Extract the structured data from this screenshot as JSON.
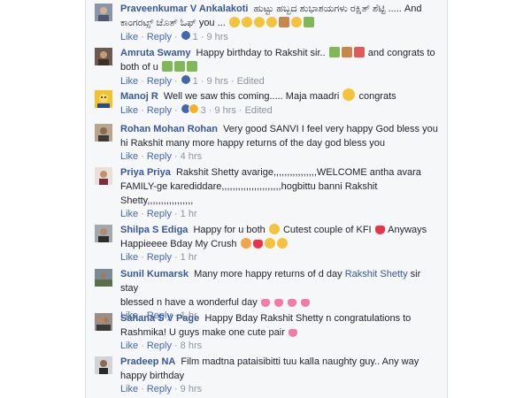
{
  "comments": [
    {
      "author": "Praveenkumar V Ankalakoti",
      "text1": "ಹುಟ್ಟು ಹಬ್ಬದ ಶುಭಾಶಯಗಳು ರಕ್ಷಿತ್ ಶೆಟ್ಟಿ ..... And",
      "text2": "ಕಾಂಗರಟ್ಸ್ ಚೊತ್ ಓಫ್ you ...",
      "like": "Like",
      "reply": "Reply",
      "reactions": "1",
      "time": "9 hrs"
    },
    {
      "author": "Amruta Swamy",
      "text1": "Happy birthday to Rakshit sir..",
      "text1b": "and congrats to",
      "text2": "both of u",
      "like": "Like",
      "reply": "Reply",
      "reactions": "1",
      "time": "9 hrs",
      "edited": "Edited"
    },
    {
      "author": "Manoj R",
      "text1": "Well we saw this coming..... Maja maadri",
      "text1b": "congrats",
      "like": "Like",
      "reply": "Reply",
      "reactions": "3",
      "time": "9 hrs",
      "edited": "Edited"
    },
    {
      "author": "Rohan Mohan Rohan",
      "text1": "Very good SANVI I feel very happy God bless you",
      "text2": "hi Rakshit many more happy returns of the day god bless you",
      "like": "Like",
      "reply": "Reply",
      "time": "4 hrs"
    },
    {
      "author": "Priya Priya",
      "text1": "Rakshit Shetty avarige,,,,,,,,,,,,,,,,WELCOME antha avara",
      "text2": "FAMILY-ge karediddare,,,,,,,,,,,,,,,,,,,,,,hogbittu banni Rakshit",
      "text3": "Shetty,,,,,,,,,,,,,,,,,",
      "like": "Like",
      "reply": "Reply",
      "time": "1 hr"
    },
    {
      "author": "Shilpa S Ediga",
      "text1": "Happy for u both",
      "text1b": "Cutest couple of KFI",
      "text1c": "Anyways",
      "text2": "Happieeee Bday My Crush",
      "like": "Like",
      "reply": "Reply",
      "time": "1 hr"
    },
    {
      "author": "Sunil Kumarsk",
      "text1": "Many more happy returns of d day",
      "mention": "Rakshit Shetty",
      "text1b": "sir stay",
      "text2": "blessed n have a wonderful day",
      "like": "Like",
      "reply": "Reply",
      "time": "1 hr"
    },
    {
      "author": "Sahana S V Page",
      "text1": "Happy Bday Rakshit Shetty n congratulations to",
      "text2": "Rashmika! U guys make one cute pair",
      "like": "Like",
      "reply": "Reply",
      "time": "8 hrs"
    },
    {
      "author": "Pradeep NA",
      "text1": "Film madtna pataisibitti tuu kalla naughty guy.. Any way",
      "text2": "happy birthday",
      "like": "Like",
      "reply": "Reply",
      "time": "9 hrs"
    }
  ],
  "colors": {
    "link": "#365899",
    "action": "#4267b2",
    "meta": "#8d949e"
  }
}
